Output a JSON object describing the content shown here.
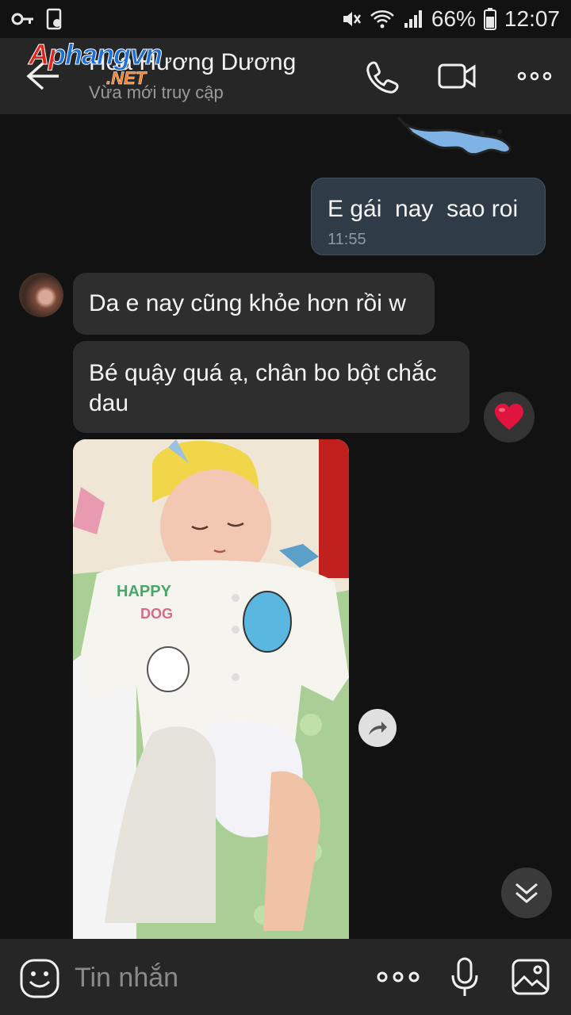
{
  "status_bar": {
    "battery": "66%",
    "time": "12:07"
  },
  "watermark": {
    "brand": "Aphangvn",
    "suffix": ".NET"
  },
  "header": {
    "contact_name": "Hoa Hương Dương",
    "contact_status": "Vừa mới truy cập"
  },
  "messages": {
    "outgoing": {
      "text": "E gái  nay  sao roi",
      "time": "11:55"
    },
    "incoming": [
      {
        "text": "Da e nay cũng khỏe hơn rồi w"
      },
      {
        "text": "Bé quậy quá ạ, chân bo bột chắc dau",
        "reaction": "heart"
      }
    ],
    "photo": {
      "shirt_text_1": "HAPPY",
      "shirt_text_2": "DOG"
    }
  },
  "composer": {
    "placeholder": "Tin nhắn"
  },
  "colors": {
    "background": "#121212",
    "header": "#262626",
    "outgoing_bubble": "#2f3b47",
    "incoming_bubble": "#2e2e2e"
  }
}
